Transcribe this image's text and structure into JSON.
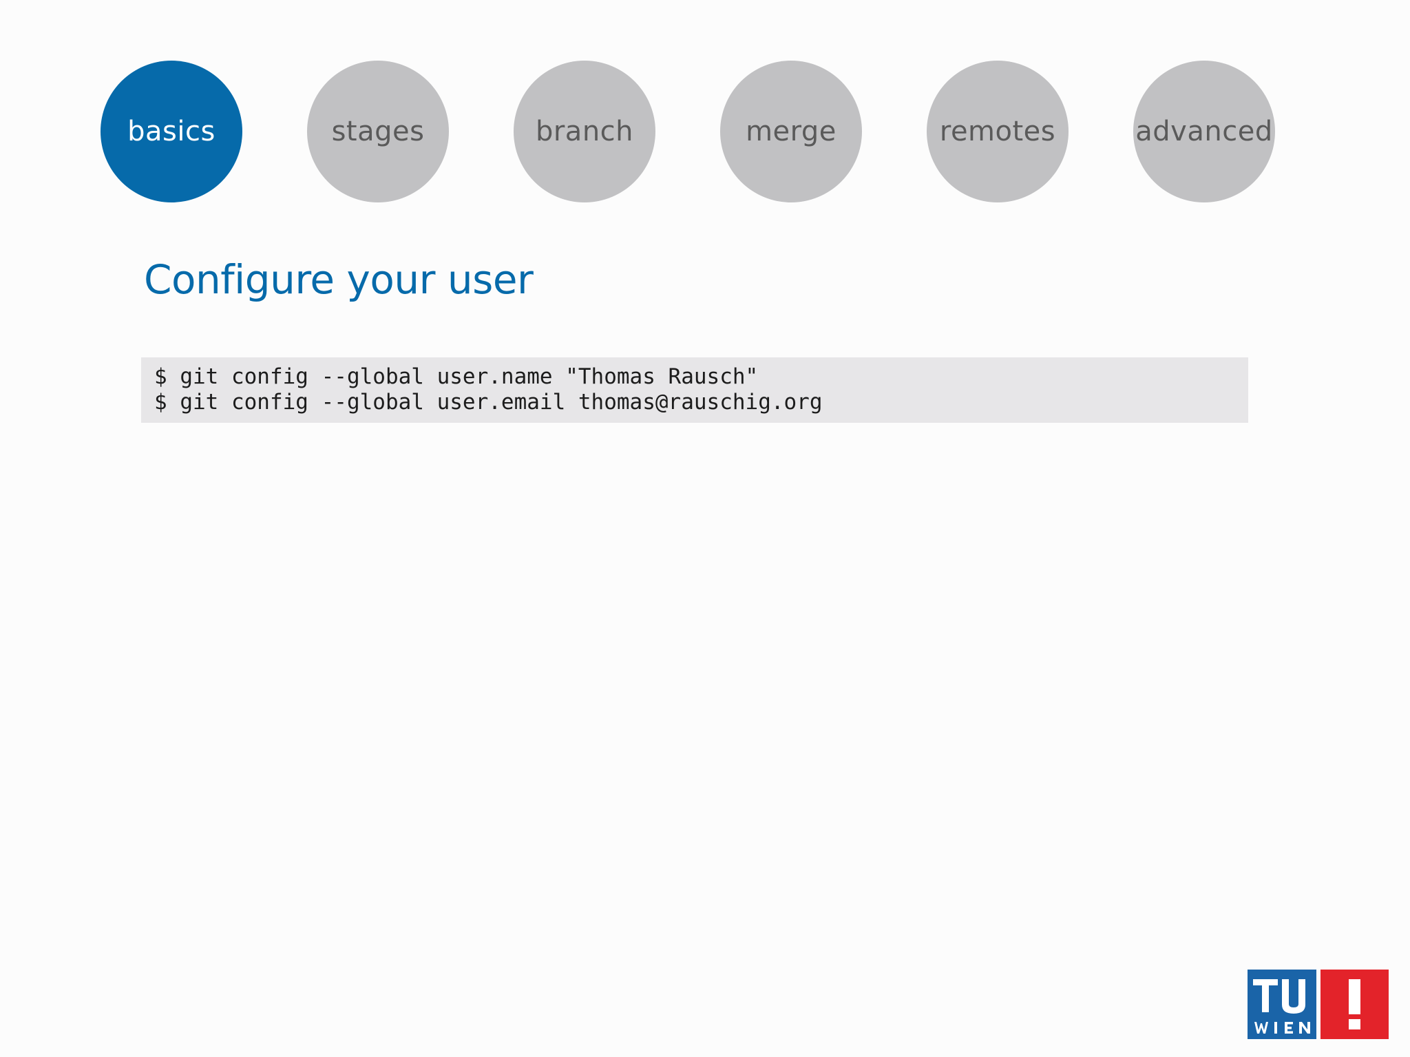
{
  "nav": {
    "items": [
      {
        "label": "basics",
        "active": true
      },
      {
        "label": "stages",
        "active": false
      },
      {
        "label": "branch",
        "active": false
      },
      {
        "label": "merge",
        "active": false
      },
      {
        "label": "remotes",
        "active": false
      },
      {
        "label": "advanced",
        "active": false
      }
    ]
  },
  "slide": {
    "title": "Configure your user",
    "code_lines": [
      "$ git config --global user.name \"Thomas Rausch\"",
      "$ git config --global user.email thomas@rauschig.org"
    ]
  },
  "logo": {
    "text": "TU WIEN",
    "blue": "#1a64a8",
    "red": "#e3232a"
  },
  "colors": {
    "accent": "#066aaa",
    "inactive_nav": "#c1c1c3",
    "code_background": "#e7e6e8"
  }
}
